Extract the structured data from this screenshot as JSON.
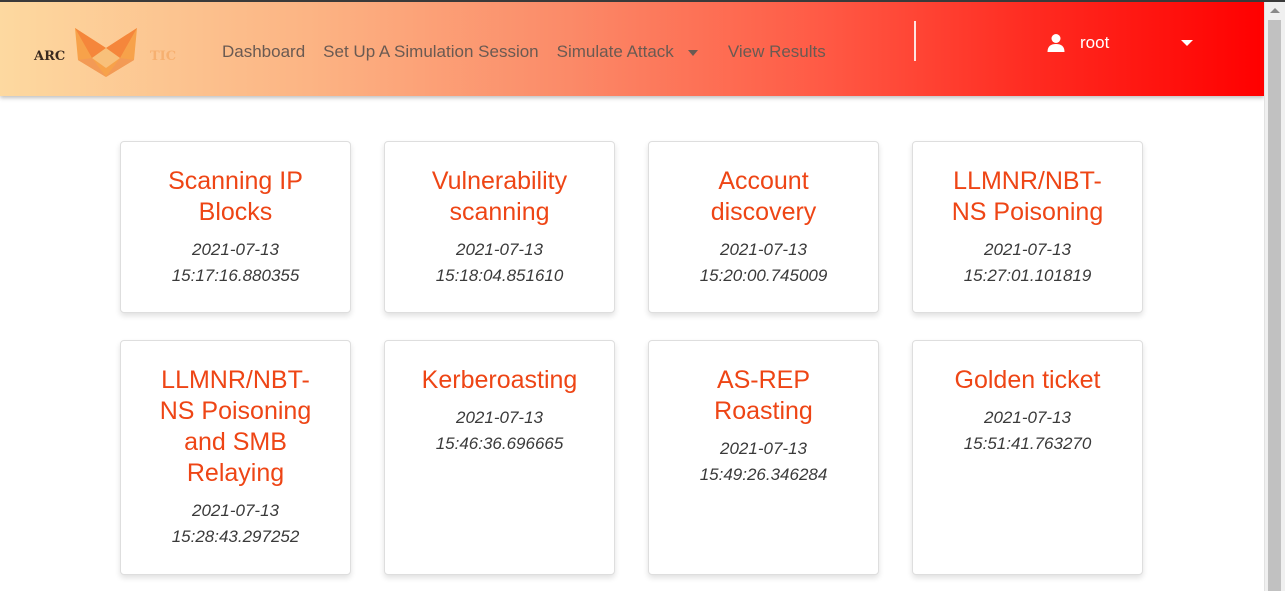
{
  "navbar": {
    "logo_text_left": "ARC",
    "logo_text_right": "TIC",
    "links": [
      {
        "label": "Dashboard"
      },
      {
        "label": "Set Up A Simulation Session"
      },
      {
        "label": "Simulate Attack"
      },
      {
        "label": "View Results"
      }
    ],
    "user": {
      "name": "root",
      "icon": "user-icon"
    }
  },
  "cards": [
    {
      "title": "Scanning IP Blocks",
      "date": "2021-07-13",
      "time": "15:17:16.880355"
    },
    {
      "title": "Vulnerability scanning",
      "date": "2021-07-13",
      "time": "15:18:04.851610"
    },
    {
      "title": "Account discovery",
      "date": "2021-07-13",
      "time": "15:20:00.745009"
    },
    {
      "title": "LLMNR/NBT-NS Poisoning",
      "date": "2021-07-13",
      "time": "15:27:01.101819"
    },
    {
      "title": "LLMNR/NBT-NS Poisoning and SMB Relaying",
      "date": "2021-07-13",
      "time": "15:28:43.297252"
    },
    {
      "title": "Kerberoasting",
      "date": "2021-07-13",
      "time": "15:46:36.696665"
    },
    {
      "title": "AS-REP Roasting",
      "date": "2021-07-13",
      "time": "15:49:26.346284"
    },
    {
      "title": "Golden ticket",
      "date": "2021-07-13",
      "time": "15:51:41.763270"
    }
  ],
  "colors": {
    "accent": "#ee4515",
    "nav_gradient_start": "#fdd9a0",
    "nav_gradient_end": "#ff0000"
  }
}
